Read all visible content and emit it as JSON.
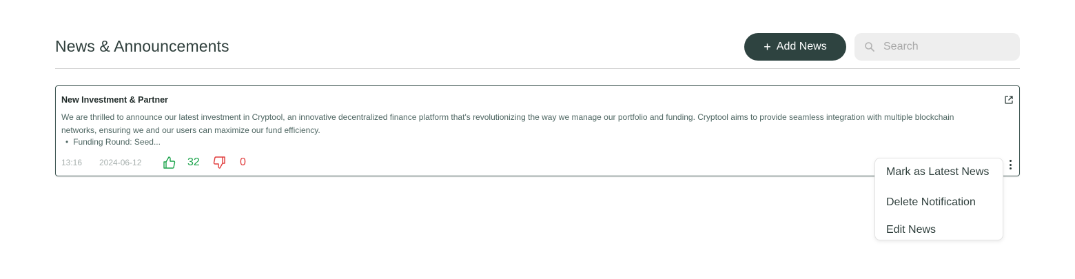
{
  "header": {
    "title": "News & Announcements",
    "add_button_label": "Add News",
    "add_icon": "+",
    "search_placeholder": "Search"
  },
  "news": [
    {
      "title": "New Investment & Partner",
      "body": "We are thrilled to announce our latest investment in Cryptool, an innovative decentralized finance platform that's revolutionizing the way we manage our portfolio and funding. Cryptool aims to provide seamless integration with multiple blockchain networks, ensuring we and our users can maximize our fund efficiency.",
      "bullet": "Funding Round: Seed...",
      "time": "13:16",
      "date": "2024-06-12",
      "likes": "32",
      "dislikes": "0"
    }
  ],
  "context_menu": {
    "items": [
      "Mark as Latest News",
      "Delete Notification",
      "Edit News"
    ]
  },
  "colors": {
    "primary": "#2e4340",
    "like": "#1aa34a",
    "dislike": "#e03a3a"
  }
}
